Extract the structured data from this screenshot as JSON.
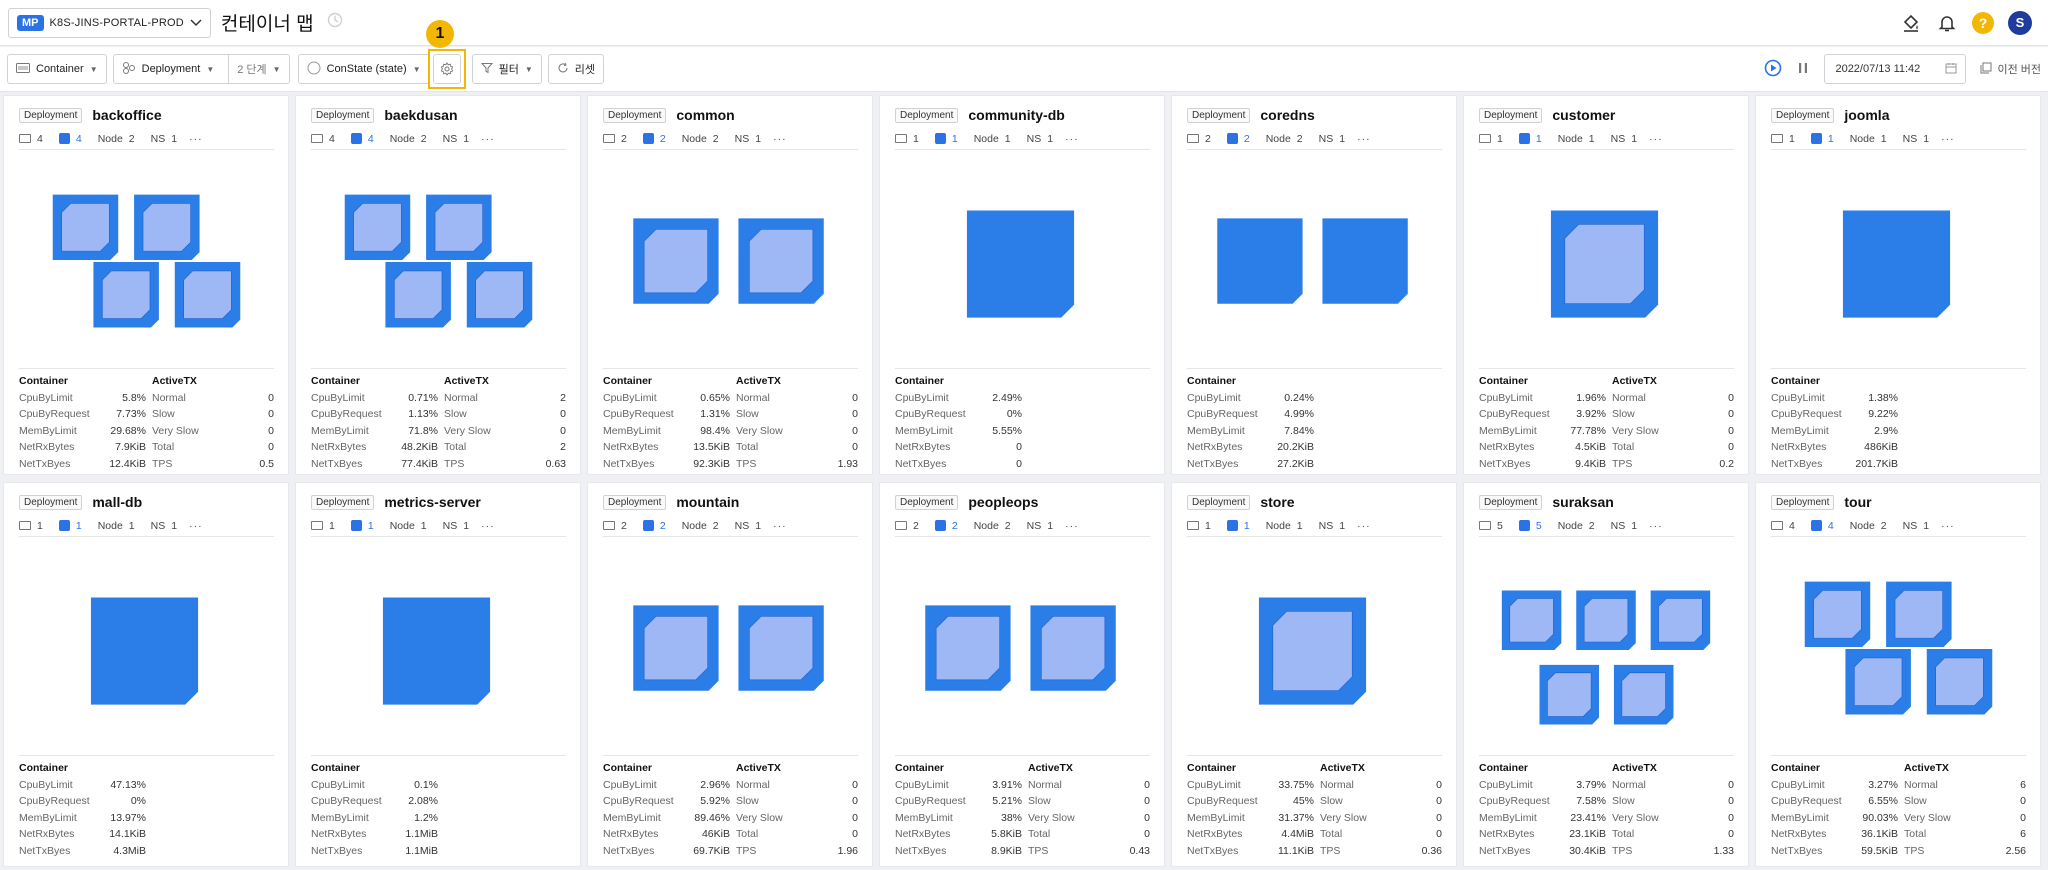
{
  "header": {
    "project_badge": "MP",
    "project_name": "K8S-JINS-PORTAL-PROD",
    "page_title": "컨테이너 맵"
  },
  "toolbar": {
    "container_label": "Container",
    "deployment_label": "Deployment",
    "depth_label": "2 단계",
    "state_label": "ConState (state)",
    "filter_label": "필터",
    "reset_label": "리셋",
    "callout_number": "1",
    "datetime": "2022/07/13 11:42",
    "prev_version_label": "이전 버전"
  },
  "colors": {
    "accent": "#2b72e5",
    "highlight": "#f2b705",
    "container_fill": "#2b7de8",
    "container_inner": "#9db8f5"
  },
  "labels": {
    "kind": "Deployment",
    "node": "Node",
    "ns": "NS",
    "container": "Container",
    "activetx": "ActiveTX",
    "metrics": [
      "CpuByLimit",
      "CpuByRequest",
      "MemByLimit",
      "NetRxBytes",
      "NetTxByes"
    ],
    "tx": [
      "Normal",
      "Slow",
      "Very Slow",
      "Total",
      "TPS"
    ]
  },
  "cards": [
    {
      "name": "backoffice",
      "hosts": "4",
      "containers": "4",
      "nodes": "2",
      "ns": "1",
      "inner": true,
      "m": [
        "5.8%",
        "7.73%",
        "29.68%",
        "7.9KiB",
        "12.4KiB"
      ],
      "tx": [
        "0",
        "0",
        "0",
        "0",
        "0.5"
      ]
    },
    {
      "name": "baekdusan",
      "hosts": "4",
      "containers": "4",
      "nodes": "2",
      "ns": "1",
      "inner": true,
      "m": [
        "0.71%",
        "1.13%",
        "71.8%",
        "48.2KiB",
        "77.4KiB"
      ],
      "tx": [
        "2",
        "0",
        "0",
        "2",
        "0.63"
      ]
    },
    {
      "name": "common",
      "hosts": "2",
      "containers": "2",
      "nodes": "2",
      "ns": "1",
      "inner": true,
      "m": [
        "0.65%",
        "1.31%",
        "98.4%",
        "13.5KiB",
        "92.3KiB"
      ],
      "tx": [
        "0",
        "0",
        "0",
        "0",
        "1.93"
      ]
    },
    {
      "name": "community-db",
      "hosts": "1",
      "containers": "1",
      "nodes": "1",
      "ns": "1",
      "inner": false,
      "m": [
        "2.49%",
        "0%",
        "5.55%",
        "0",
        "0"
      ],
      "tx": null
    },
    {
      "name": "coredns",
      "hosts": "2",
      "containers": "2",
      "nodes": "2",
      "ns": "1",
      "inner": false,
      "m": [
        "0.24%",
        "4.99%",
        "7.84%",
        "20.2KiB",
        "27.2KiB"
      ],
      "tx": null
    },
    {
      "name": "customer",
      "hosts": "1",
      "containers": "1",
      "nodes": "1",
      "ns": "1",
      "inner": true,
      "m": [
        "1.96%",
        "3.92%",
        "77.78%",
        "4.5KiB",
        "9.4KiB"
      ],
      "tx": [
        "0",
        "0",
        "0",
        "0",
        "0.2"
      ]
    },
    {
      "name": "joomla",
      "hosts": "1",
      "containers": "1",
      "nodes": "1",
      "ns": "1",
      "inner": false,
      "m": [
        "1.38%",
        "9.22%",
        "2.9%",
        "486KiB",
        "201.7KiB"
      ],
      "tx": null
    },
    {
      "name": "mall-db",
      "hosts": "1",
      "containers": "1",
      "nodes": "1",
      "ns": "1",
      "inner": false,
      "m": [
        "47.13%",
        "0%",
        "13.97%",
        "14.1KiB",
        "4.3MiB"
      ],
      "tx": null
    },
    {
      "name": "metrics-server",
      "hosts": "1",
      "containers": "1",
      "nodes": "1",
      "ns": "1",
      "inner": false,
      "m": [
        "0.1%",
        "2.08%",
        "1.2%",
        "1.1MiB",
        "1.1MiB"
      ],
      "tx": null
    },
    {
      "name": "mountain",
      "hosts": "2",
      "containers": "2",
      "nodes": "2",
      "ns": "1",
      "inner": true,
      "m": [
        "2.96%",
        "5.92%",
        "89.46%",
        "46KiB",
        "69.7KiB"
      ],
      "tx": [
        "0",
        "0",
        "0",
        "0",
        "1.96"
      ]
    },
    {
      "name": "peopleops",
      "hosts": "2",
      "containers": "2",
      "nodes": "2",
      "ns": "1",
      "inner": true,
      "m": [
        "3.91%",
        "5.21%",
        "38%",
        "5.8KiB",
        "8.9KiB"
      ],
      "tx": [
        "0",
        "0",
        "0",
        "0",
        "0.43"
      ]
    },
    {
      "name": "store",
      "hosts": "1",
      "containers": "1",
      "nodes": "1",
      "ns": "1",
      "inner": true,
      "m": [
        "33.75%",
        "45%",
        "31.37%",
        "4.4MiB",
        "11.1KiB"
      ],
      "tx": [
        "0",
        "0",
        "0",
        "0",
        "0.36"
      ]
    },
    {
      "name": "suraksan",
      "hosts": "5",
      "containers": "5",
      "nodes": "2",
      "ns": "1",
      "inner": true,
      "m": [
        "3.79%",
        "7.58%",
        "23.41%",
        "23.1KiB",
        "30.4KiB"
      ],
      "tx": [
        "0",
        "0",
        "0",
        "0",
        "1.33"
      ]
    },
    {
      "name": "tour",
      "hosts": "4",
      "containers": "4",
      "nodes": "2",
      "ns": "1",
      "inner": true,
      "m": [
        "3.27%",
        "6.55%",
        "90.03%",
        "36.1KiB",
        "59.5KiB"
      ],
      "tx": [
        "6",
        "0",
        "0",
        "6",
        "2.56"
      ]
    }
  ]
}
